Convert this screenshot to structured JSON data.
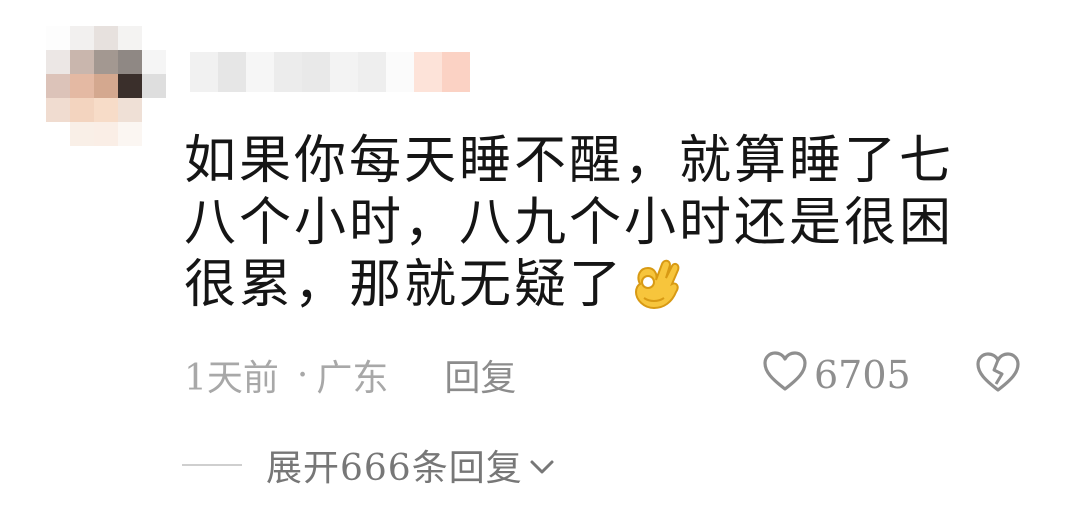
{
  "comment": {
    "text": "如果你每天睡不醒，就算睡了七八个小时，八九个小时还是很困很累，那就无疑了",
    "emoji": "ok-hand",
    "time": "1天前",
    "separator": "·",
    "location": "广东",
    "reply_label": "回复",
    "like_count": "6705",
    "expand_label": "展开666条回复"
  },
  "colors": {
    "text": "#151515",
    "meta": "#a8a8a8",
    "icon": "#8f8f8f"
  }
}
